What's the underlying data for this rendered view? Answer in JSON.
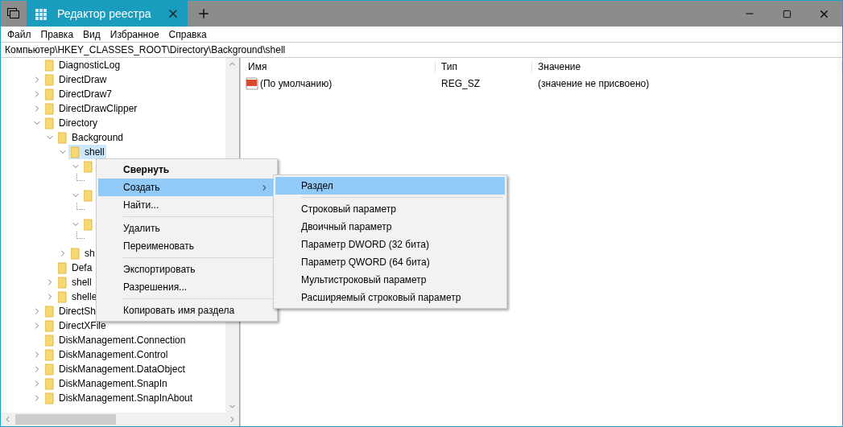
{
  "window": {
    "tab_title": "Редактор реестра"
  },
  "menu_bar": [
    "Файл",
    "Правка",
    "Вид",
    "Избранное",
    "Справка"
  ],
  "address": "Компьютер\\HKEY_CLASSES_ROOT\\Directory\\Background\\shell",
  "tree": [
    {
      "label": "DiagnosticLog",
      "selected": false
    },
    {
      "label": "DirectDraw",
      "expanded": false,
      "selected": false
    },
    {
      "label": "DirectDraw7",
      "expanded": false,
      "selected": false
    },
    {
      "label": "DirectDrawClipper",
      "expanded": false,
      "selected": false
    },
    {
      "label": "Directory",
      "expanded": true,
      "selected": false,
      "children": [
        {
          "label": "Background",
          "expanded": true,
          "selected": false,
          "children": [
            {
              "label": "shell",
              "expanded": true,
              "selected": true,
              "children": [
                {
                  "expanded": true,
                  "children": [
                    {
                      "kind": "hidden"
                    }
                  ]
                },
                {
                  "expanded": true,
                  "children": [
                    {
                      "kind": "hidden"
                    }
                  ]
                },
                {
                  "expanded": true,
                  "children": [
                    {
                      "kind": "hidden"
                    }
                  ]
                }
              ]
            },
            {
              "label": "sh",
              "expanded": false,
              "selected": false
            }
          ]
        },
        {
          "label": "Defa",
          "selected": false
        },
        {
          "label": "shell",
          "expanded": false,
          "selected": false
        },
        {
          "label": "shelle",
          "expanded": false,
          "selected": false
        }
      ]
    },
    {
      "label": "DirectSh",
      "expanded": false,
      "selected": false
    },
    {
      "label": "DirectXFile",
      "expanded": false,
      "selected": false
    },
    {
      "label": "DiskManagement.Connection",
      "selected": false
    },
    {
      "label": "DiskManagement.Control",
      "expanded": false,
      "selected": false
    },
    {
      "label": "DiskManagement.DataObject",
      "expanded": false,
      "selected": false
    },
    {
      "label": "DiskManagement.SnapIn",
      "expanded": false,
      "selected": false
    },
    {
      "label": "DiskManagement.SnapInAbout",
      "expanded": false,
      "selected": false
    }
  ],
  "table": {
    "columns": [
      "Имя",
      "Тип",
      "Значение"
    ],
    "rows": [
      {
        "name": "(По умолчанию)",
        "type": "REG_SZ",
        "value": "(значение не присвоено)"
      }
    ]
  },
  "context_menu": [
    {
      "kind": "item",
      "label": "Свернуть",
      "default": true,
      "submenu": false,
      "selected": false
    },
    {
      "kind": "item",
      "label": "Создать",
      "default": false,
      "submenu": true,
      "selected": true
    },
    {
      "kind": "item",
      "label": "Найти...",
      "default": false,
      "submenu": false,
      "selected": false
    },
    {
      "kind": "separator"
    },
    {
      "kind": "item",
      "label": "Удалить",
      "default": false,
      "submenu": false,
      "selected": false
    },
    {
      "kind": "item",
      "label": "Переименовать",
      "default": false,
      "submenu": false,
      "selected": false
    },
    {
      "kind": "separator"
    },
    {
      "kind": "item",
      "label": "Экспортировать",
      "default": false,
      "submenu": false,
      "selected": false
    },
    {
      "kind": "item",
      "label": "Разрешения...",
      "default": false,
      "submenu": false,
      "selected": false
    },
    {
      "kind": "separator"
    },
    {
      "kind": "item",
      "label": "Копировать имя раздела",
      "default": false,
      "submenu": false,
      "selected": false
    }
  ],
  "submenu": [
    {
      "kind": "item",
      "label": "Раздел",
      "selected": true
    },
    {
      "kind": "separator"
    },
    {
      "kind": "item",
      "label": "Строковый параметр",
      "selected": false
    },
    {
      "kind": "item",
      "label": "Двоичный параметр",
      "selected": false
    },
    {
      "kind": "item",
      "label": "Параметр DWORD (32 бита)",
      "selected": false
    },
    {
      "kind": "item",
      "label": "Параметр QWORD (64 бита)",
      "selected": false
    },
    {
      "kind": "item",
      "label": "Мультистроковый параметр",
      "selected": false
    },
    {
      "kind": "item",
      "label": "Расширяемый строковый параметр",
      "selected": false
    }
  ]
}
